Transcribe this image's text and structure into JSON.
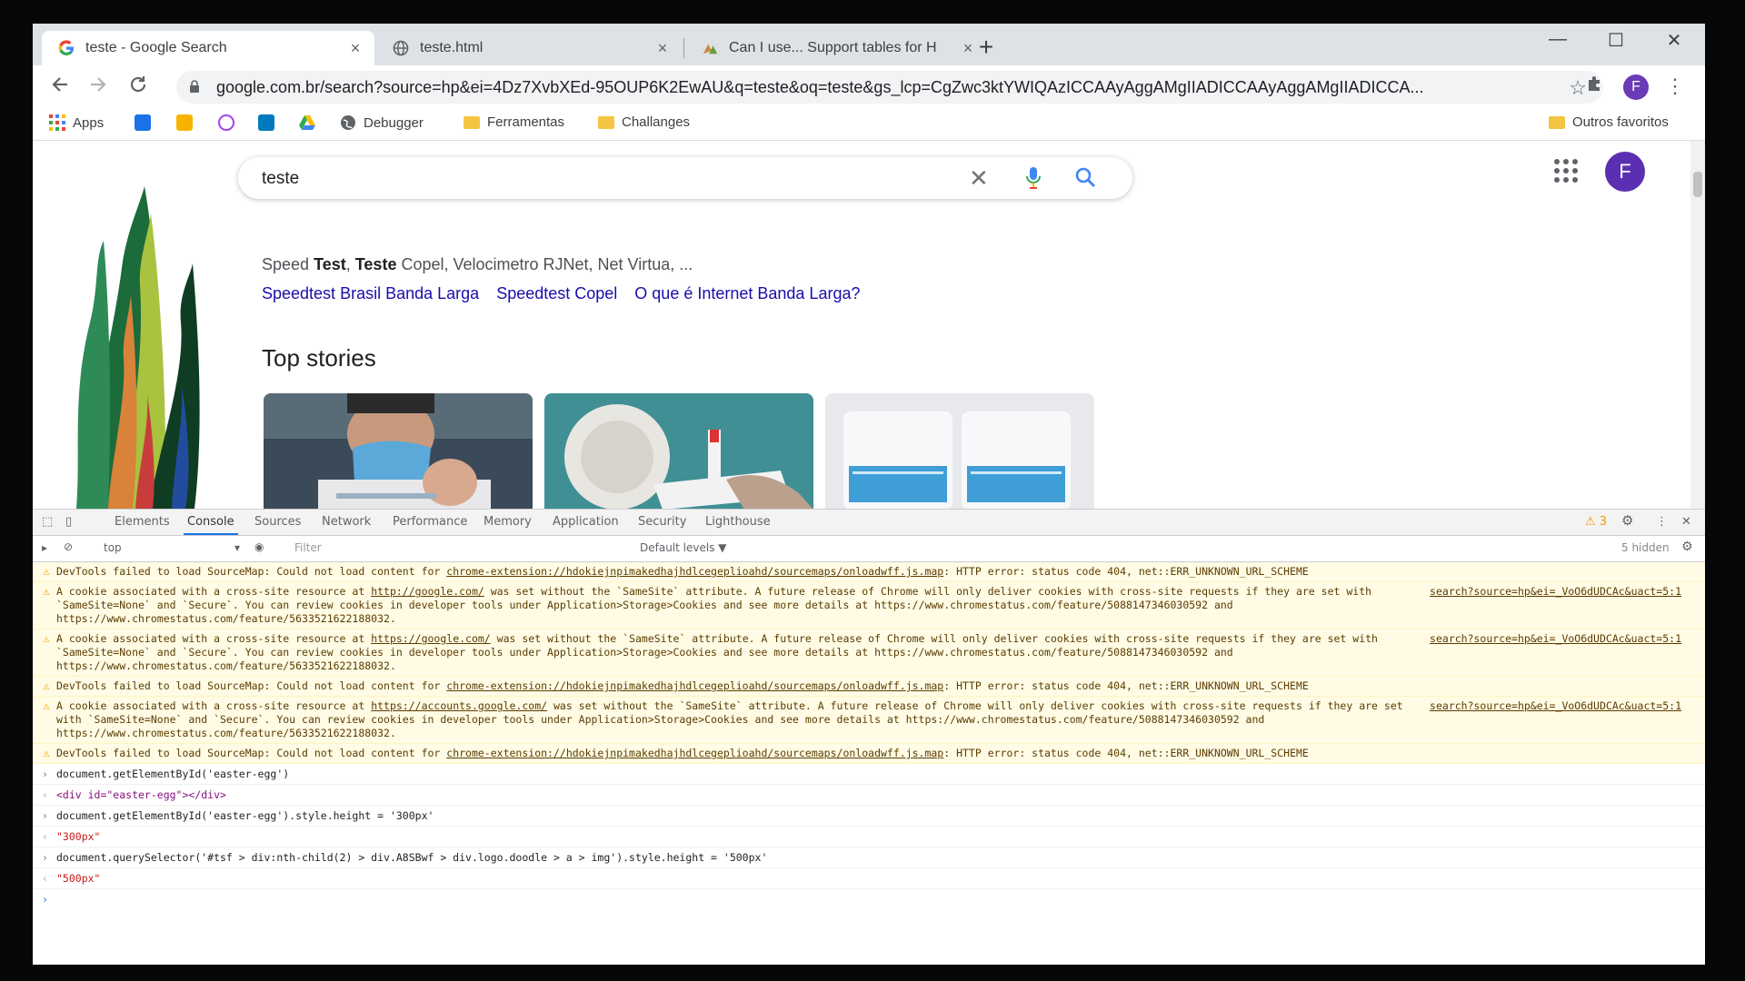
{
  "tabs": [
    {
      "title": "teste - Google Search",
      "close": "×"
    },
    {
      "title": "teste.html",
      "close": "×"
    },
    {
      "title": "Can I use... Support tables for H",
      "close": "×"
    }
  ],
  "new_tab": "+",
  "window_controls": {
    "minimize": "—",
    "maximize": "☐",
    "close": "✕"
  },
  "toolbar": {
    "url": "google.com.br/search?source=hp&ei=4Dz7XvbXEd-95OUP6K2EwAU&q=teste&oq=teste&gs_lcp=CgZwc3ktYWIQAzICCAAyAggAMgIIADICCAAyAggAMgIIADICCA...",
    "profile_initial": "F"
  },
  "bookmarks": {
    "apps": "Apps",
    "debugger": "Debugger",
    "ferramentas": "Ferramentas",
    "challanges": "Challanges",
    "other": "Outros favoritos"
  },
  "search": {
    "query": "teste",
    "snippet_parts": [
      "Speed ",
      "Test",
      ", ",
      "Teste",
      " Copel, Velocimetro RJNet, Net Virtua, ..."
    ],
    "related_links": [
      "Speedtest Brasil Banda Larga",
      "Speedtest Copel",
      "O que é Internet Banda Larga?"
    ],
    "top_stories_heading": "Top stories",
    "profile_initial": "F"
  },
  "devtools": {
    "tabs": [
      "Elements",
      "Console",
      "Sources",
      "Network",
      "Performance",
      "Memory",
      "Application",
      "Security",
      "Lighthouse"
    ],
    "warning_count": "3",
    "context": "top",
    "filter_placeholder": "Filter",
    "levels": "Default levels ▼",
    "hidden_count": "5 hidden"
  },
  "console": {
    "messages": [
      {
        "pre": "DevTools failed to load SourceMap: Could not load content for ",
        "link": "chrome-extension://hdokiejnpimakedhajhdlcegeplioahd/sourcemaps/onloadwff.js.map",
        "post": ": HTTP error: status code 404, net::ERR_UNKNOWN_URL_SCHEME",
        "source": ""
      },
      {
        "pre": "A cookie associated with a cross-site resource at ",
        "link": "http://google.com/",
        "post": " was set without the `SameSite` attribute. A future release of Chrome will only deliver cookies with cross-site requests if they are set with `SameSite=None` and `Secure`. You can review cookies in developer tools under Application>Storage>Cookies and see more details at https://www.chromestatus.com/feature/5088147346030592 and https://www.chromestatus.com/feature/5633521622188032.",
        "source": "search?source=hp&ei=_VoO6dUDCAc&uact=5:1"
      },
      {
        "pre": "A cookie associated with a cross-site resource at ",
        "link": "https://google.com/",
        "post": " was set without the `SameSite` attribute. A future release of Chrome will only deliver cookies with cross-site requests if they are set with `SameSite=None` and `Secure`. You can review cookies in developer tools under Application>Storage>Cookies and see more details at https://www.chromestatus.com/feature/5088147346030592 and https://www.chromestatus.com/feature/5633521622188032.",
        "source": "search?source=hp&ei=_VoO6dUDCAc&uact=5:1"
      },
      {
        "pre": "DevTools failed to load SourceMap: Could not load content for ",
        "link": "chrome-extension://hdokiejnpimakedhajhdlcegeplioahd/sourcemaps/onloadwff.js.map",
        "post": ": HTTP error: status code 404, net::ERR_UNKNOWN_URL_SCHEME",
        "source": ""
      },
      {
        "pre": "A cookie associated with a cross-site resource at ",
        "link": "https://accounts.google.com/",
        "post": " was set without the `SameSite` attribute. A future release of Chrome will only deliver cookies with cross-site requests if they are set with `SameSite=None` and `Secure`. You can review cookies in developer tools under Application>Storage>Cookies and see more details at https://www.chromestatus.com/feature/5088147346030592 and https://www.chromestatus.com/feature/5633521622188032.",
        "source": "search?source=hp&ei=_VoO6dUDCAc&uact=5:1"
      },
      {
        "pre": "DevTools failed to load SourceMap: Could not load content for ",
        "link": "chrome-extension://hdokiejnpimakedhajhdlcegeplioahd/sourcemaps/onloadwff.js.map",
        "post": ": HTTP error: status code 404, net::ERR_UNKNOWN_URL_SCHEME",
        "source": ""
      }
    ],
    "cmd1": "document.getElementById('easter-egg')",
    "res1": "<div id=\"easter-egg\"></div>",
    "cmd2": "document.getElementById('easter-egg').style.height = '300px'",
    "res2": "\"300px\"",
    "cmd3": "document.querySelector('#tsf > div:nth-child(2) > div.A8SBwf > div.logo.doodle > a > img').style.height = '500px'",
    "res3": "\"500px\""
  }
}
